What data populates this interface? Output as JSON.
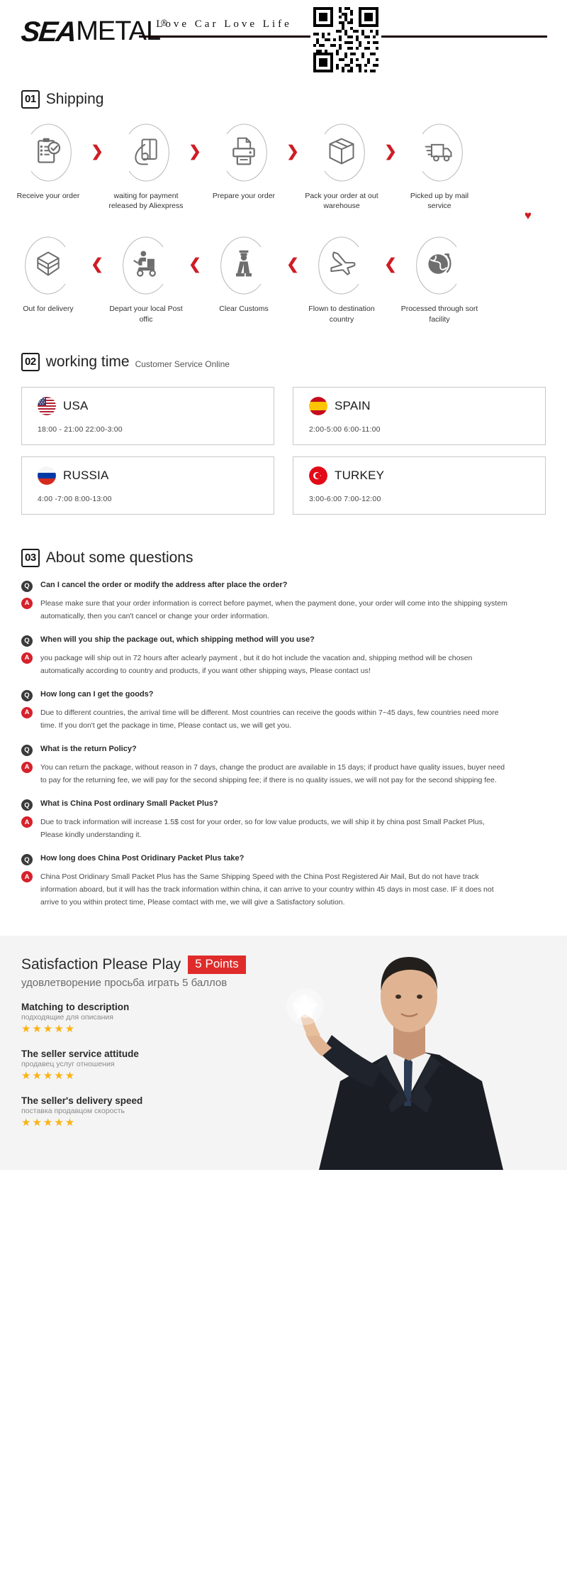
{
  "brand": {
    "logo_primary": "SEA",
    "logo_secondary": "METAL",
    "registered_mark": "®",
    "slogan": "Love Car Love Life",
    "qr_code_label": "qr-code"
  },
  "sections": {
    "shipping": {
      "number": "01",
      "title": "Shipping"
    },
    "working_time": {
      "number": "02",
      "title": "working time",
      "subtitle": "Customer Service Online"
    },
    "faq": {
      "number": "03",
      "title": "About some questions"
    }
  },
  "shipping_steps_row1": [
    {
      "icon": "clipboard-check-icon",
      "label": "Receive your order"
    },
    {
      "icon": "hand-card-icon",
      "label": "waiting for payment released by Aliexpress"
    },
    {
      "icon": "printer-icon",
      "label": "Prepare your order"
    },
    {
      "icon": "package-box-icon",
      "label": "Pack your order at out warehouse"
    },
    {
      "icon": "delivery-truck-icon",
      "label": "Picked up by mail service"
    }
  ],
  "shipping_steps_row2": [
    {
      "icon": "open-box-icon",
      "label": "Out  for delivery"
    },
    {
      "icon": "scooter-courier-icon",
      "label": "Depart your local Post offic"
    },
    {
      "icon": "customs-officer-icon",
      "label": "Clear Customs"
    },
    {
      "icon": "airplane-icon",
      "label": "Flown to destination country"
    },
    {
      "icon": "globe-arrow-icon",
      "label": "Processed through sort facility"
    }
  ],
  "shipping_separators": {
    "forward": "❯",
    "backward": "❮",
    "down": "♥"
  },
  "working_time_cards": [
    {
      "country": "USA",
      "flag": "usa-flag-icon",
      "hours": "18:00 - 21:00   22:00-3:00"
    },
    {
      "country": "SPAIN",
      "flag": "spain-flag-icon",
      "hours": "2:00-5:00     6:00-11:00"
    },
    {
      "country": "RUSSIA",
      "flag": "russia-flag-icon",
      "hours": "4:00 -7:00   8:00-13:00"
    },
    {
      "country": "TURKEY",
      "flag": "turkey-flag-icon",
      "hours": "3:00-6:00    7:00-12:00"
    }
  ],
  "faq_badges": {
    "question": "Q",
    "answer": "A"
  },
  "faq": [
    {
      "question": "Can I cancel the order or modify the address after place the order?",
      "answer": "Please make sure that your order information is correct before paymet, when the payment done, your order will come into the shipping system automatically, then you can't cancel or change your order information."
    },
    {
      "question": "When will you ship the package out, which shipping method will you use?",
      "answer": "you package will ship out in 72 hours after aclearly payment , but it do hot include the vacation and, shipping method will be chosen automatically according to country and products, if you want other shipping ways, Please contact us!"
    },
    {
      "question": "How long can I get the goods?",
      "answer": "Due to different countries, the arrival time will be different. Most countries can receive the goods within 7~45 days, few countries need more time. If you don't get the package in time, Please contact us, we will get you."
    },
    {
      "question": "What is the return Policy?",
      "answer": "You can return the package, without reason in 7 days, change the product are available in 15 days; if product have quality issues, buyer need to pay for the returning fee, we will pay for the second shipping fee; if there is no quality issues, we will not pay for the second shipping fee."
    },
    {
      "question": "What is China Post ordinary Small Packet Plus?",
      "answer": "Due to track information will increase 1.5$ cost for your order, so for low value products, we will ship it by china post Small Packet Plus, Please kindly understanding it."
    },
    {
      "question": "How long does China Post Oridinary Packet Plus take?",
      "answer": "China Post Oridinary Small Packet Plus has the Same Shipping Speed with the China Post Registered Air Mail, But do not have track information aboard, but it will has the track information within china, it can arrive to your country within 45 days in most case. IF it does not arrive to you within protect time, Please comtact with me, we will give a Satisfactory solution."
    }
  ],
  "satisfaction": {
    "title": "Satisfaction Please Play",
    "points_badge": "5 Points",
    "subtitle": "удовлетворение просьба играть 5 баллов",
    "ratings": [
      {
        "en": "Matching to description",
        "ru": "подходящие для описания",
        "stars": "★★★★★"
      },
      {
        "en": "The seller service attitude",
        "ru": "продавец услуг отношения",
        "stars": "★★★★★"
      },
      {
        "en": "The seller's delivery speed",
        "ru": "поставка продавцом скорость",
        "stars": "★★★★★"
      }
    ],
    "photo": "businessman-pointing-photo"
  },
  "colors": {
    "accent_red": "#cf1c24",
    "badge_red": "#d6212b",
    "badge_dark": "#3a3a3a",
    "star_gold": "#f9b314",
    "points_red": "#e02b2b",
    "panel_gray": "#f4f4f4"
  }
}
